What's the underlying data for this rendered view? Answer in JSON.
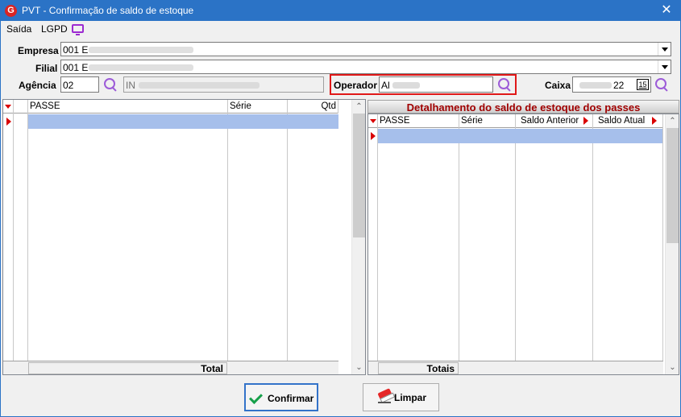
{
  "window": {
    "title": "PVT - Confirmação de saldo de estoque",
    "close_glyph": "✕"
  },
  "menu": {
    "items": [
      "Saída",
      "LGPD"
    ],
    "icon": "monitor-icon"
  },
  "form": {
    "empresa_label": "Empresa",
    "empresa_value": "001 E",
    "filial_label": "Filial",
    "filial_value": "001 E",
    "agencia_label": "Agência",
    "agencia_value": "02",
    "agencia_name_value": "IN",
    "operador_label": "Operador",
    "operador_value": "Al",
    "caixa_label": "Caixa",
    "caixa_value": "22",
    "caixa_calendar": "15"
  },
  "left_grid": {
    "columns": [
      "PASSE",
      "Série",
      "Qtd"
    ],
    "total_label": "Total"
  },
  "right_grid": {
    "title": "Detalhamento do saldo de estoque dos passes",
    "columns": [
      "PASSE",
      "Série",
      "Saldo Anterior",
      "Saldo Atual"
    ],
    "totals_label": "Totais"
  },
  "buttons": {
    "confirm_label": "Confirmar",
    "clear_label": "Limpar"
  },
  "colors": {
    "titlebar": "#2b73c6",
    "selected_row": "#a6bfeb",
    "panel_title": "#a00000",
    "highlight_box": "#e01818",
    "search_icon": "#9c5bd8"
  }
}
